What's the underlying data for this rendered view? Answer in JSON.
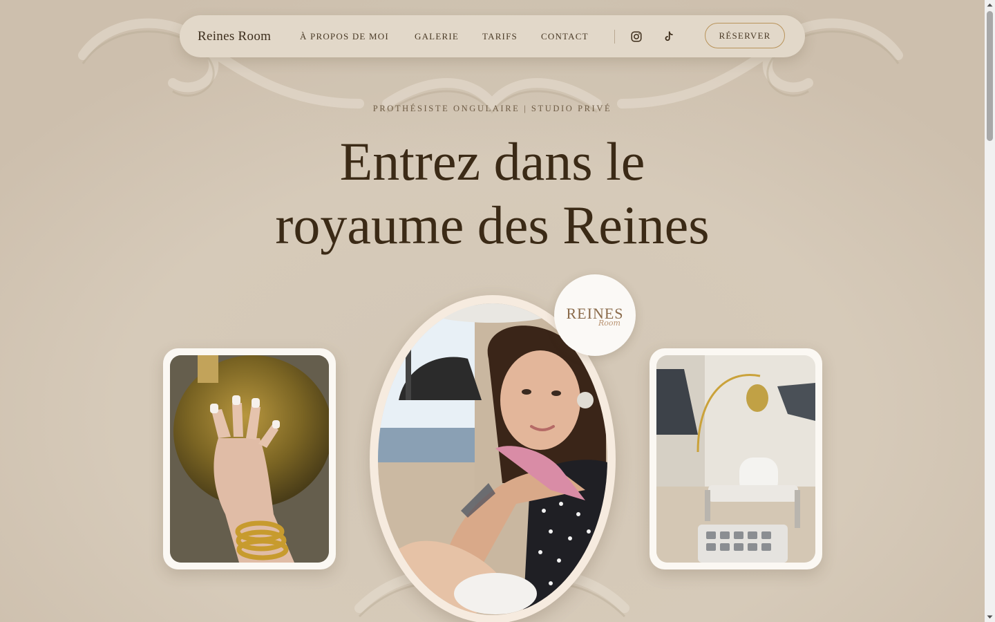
{
  "nav": {
    "brand": "Reines Room",
    "links": [
      "À PROPOS DE MOI",
      "GALERIE",
      "TARIFS",
      "CONTACT"
    ],
    "icons": [
      "instagram-icon",
      "tiktok-icon"
    ],
    "cta": "RÉSERVER"
  },
  "hero": {
    "eyebrow": "PROTHÉSISTE ONGULAIRE | STUDIO PRIVÉ",
    "headline_line1": "Entrez dans le",
    "headline_line2": "royaume des Reines"
  },
  "badge": {
    "logo_main": "REINES",
    "logo_script": "Room"
  },
  "photos": {
    "left": "nails-hand-photo",
    "center": "portrait-photo",
    "right": "studio-room-photo"
  },
  "colors": {
    "background": "#d7cbbb",
    "nav_bg": "#e2d8c9",
    "accent_gold": "#b8935a",
    "text_dark": "#3b2a16"
  }
}
